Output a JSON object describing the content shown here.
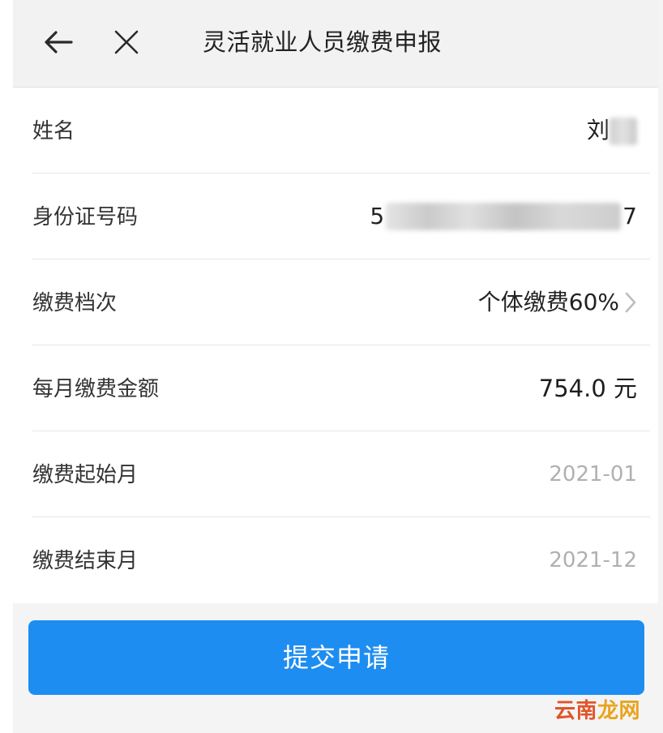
{
  "header": {
    "title": "灵活就业人员缴费申报",
    "back_icon": "arrow-left-icon",
    "close_icon": "close-icon"
  },
  "form": {
    "rows": [
      {
        "label": "姓名",
        "value": "刘"
      },
      {
        "label": "身份证号码",
        "value_prefix": "5",
        "value_suffix": "7"
      },
      {
        "label": "缴费档次",
        "value": "个体缴费60%"
      },
      {
        "label": "每月缴费金额",
        "value": "754.0 元"
      },
      {
        "label": "缴费起始月",
        "value": "2021-01"
      },
      {
        "label": "缴费结束月",
        "value": "2021-12"
      }
    ]
  },
  "submit": {
    "label": "提交申请"
  },
  "watermark": {
    "part1": "云南",
    "part2": "龙网"
  },
  "colors": {
    "accent": "#1e8df1",
    "muted_text": "#b0b0b0"
  }
}
